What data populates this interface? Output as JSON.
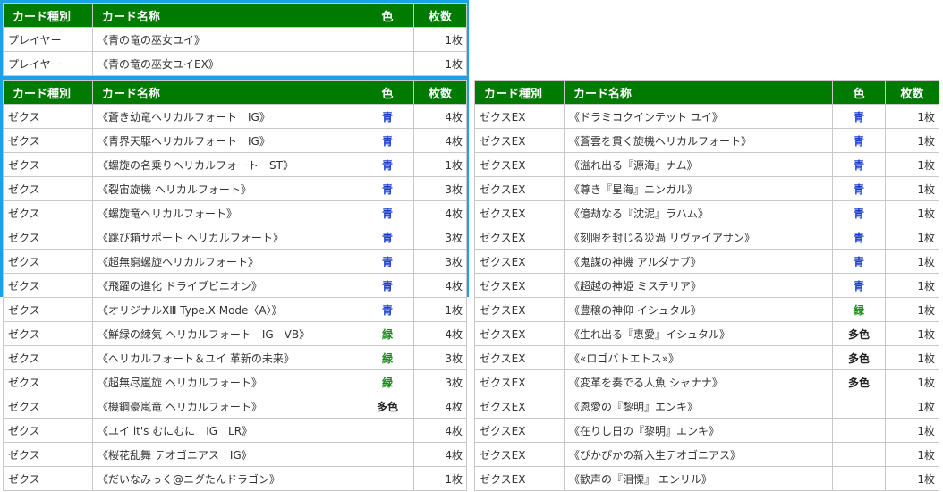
{
  "headers": {
    "type": "カード種別",
    "name": "カード名称",
    "color": "色",
    "count": "枚数"
  },
  "players": [
    {
      "type": "プレイヤー",
      "name": "《青の竜の巫女ユイ》",
      "color": "",
      "color_class": "",
      "count": "1枚"
    },
    {
      "type": "プレイヤー",
      "name": "《青の竜の巫女ユイEX》",
      "color": "",
      "color_class": "",
      "count": "1枚"
    }
  ],
  "zex": [
    {
      "type": "ゼクス",
      "name": "《蒼き幼竜ヘリカルフォート　IG》",
      "color": "青",
      "color_class": "blue",
      "count": "4枚"
    },
    {
      "type": "ゼクス",
      "name": "《青界天駆ヘリカルフォート　IG》",
      "color": "青",
      "color_class": "blue",
      "count": "4枚"
    },
    {
      "type": "ゼクス",
      "name": "《螺旋の名乗りヘリカルフォート　ST》",
      "color": "青",
      "color_class": "blue",
      "count": "1枚"
    },
    {
      "type": "ゼクス",
      "name": "《裂宙旋機 ヘリカルフォート》",
      "color": "青",
      "color_class": "blue",
      "count": "3枚"
    },
    {
      "type": "ゼクス",
      "name": "《螺旋竜ヘリカルフォート》",
      "color": "青",
      "color_class": "blue",
      "count": "4枚"
    },
    {
      "type": "ゼクス",
      "name": "《跳び箱サポート ヘリカルフォート》",
      "color": "青",
      "color_class": "blue",
      "count": "3枚"
    },
    {
      "type": "ゼクス",
      "name": "《超無窮螺旋ヘリカルフォート》",
      "color": "青",
      "color_class": "blue",
      "count": "3枚"
    },
    {
      "type": "ゼクス",
      "name": "《飛躍の進化 ドライブビニオン》",
      "color": "青",
      "color_class": "blue",
      "count": "4枚"
    },
    {
      "type": "ゼクス",
      "name": "《オリジナルXⅢ Type.X Mode〈A〉》",
      "color": "青",
      "color_class": "blue",
      "count": "1枚"
    },
    {
      "type": "ゼクス",
      "name": "《鮮緑の練気 ヘリカルフォート　IG　VB》",
      "color": "緑",
      "color_class": "green",
      "count": "4枚"
    },
    {
      "type": "ゼクス",
      "name": "《ヘリカルフォート＆ユイ 革新の未来》",
      "color": "緑",
      "color_class": "green",
      "count": "3枚"
    },
    {
      "type": "ゼクス",
      "name": "《超無尽嵐旋 ヘリカルフォート》",
      "color": "緑",
      "color_class": "green",
      "count": "3枚"
    },
    {
      "type": "ゼクス",
      "name": "《機鋼豪嵐竜 ヘリカルフォート》",
      "color": "多色",
      "color_class": "multi",
      "count": "4枚"
    },
    {
      "type": "ゼクス",
      "name": "《ユイ it's むにむに　IG　LR》",
      "color": "",
      "color_class": "",
      "count": "4枚"
    },
    {
      "type": "ゼクス",
      "name": "《桜花乱舞 テオゴニアス　IG》",
      "color": "",
      "color_class": "",
      "count": "4枚"
    },
    {
      "type": "ゼクス",
      "name": "《だいなみっく@ニグたんドラゴン》",
      "color": "",
      "color_class": "",
      "count": "1枚"
    }
  ],
  "zex_ex": [
    {
      "type": "ゼクスEX",
      "name": "《ドラミコクインテット ユイ》",
      "color": "青",
      "color_class": "blue",
      "count": "1枚"
    },
    {
      "type": "ゼクスEX",
      "name": "《蒼雲を貫く旋機ヘリカルフォート》",
      "color": "青",
      "color_class": "blue",
      "count": "1枚"
    },
    {
      "type": "ゼクスEX",
      "name": "《溢れ出る『源海』ナム》",
      "color": "青",
      "color_class": "blue",
      "count": "1枚"
    },
    {
      "type": "ゼクスEX",
      "name": "《尊き『星海』ニンガル》",
      "color": "青",
      "color_class": "blue",
      "count": "1枚"
    },
    {
      "type": "ゼクスEX",
      "name": "《億劫なる『沈泥』ラハム》",
      "color": "青",
      "color_class": "blue",
      "count": "1枚"
    },
    {
      "type": "ゼクスEX",
      "name": "《刻限を封じる災渦 リヴァイアサン》",
      "color": "青",
      "color_class": "blue",
      "count": "1枚"
    },
    {
      "type": "ゼクスEX",
      "name": "《鬼謀の神機 アルダナブ》",
      "color": "青",
      "color_class": "blue",
      "count": "1枚"
    },
    {
      "type": "ゼクスEX",
      "name": "《超越の神姫 ミステリア》",
      "color": "青",
      "color_class": "blue",
      "count": "1枚"
    },
    {
      "type": "ゼクスEX",
      "name": "《豊穣の神仰 イシュタル》",
      "color": "緑",
      "color_class": "green",
      "count": "1枚"
    },
    {
      "type": "ゼクスEX",
      "name": "《生れ出る『恵愛』イシュタル》",
      "color": "多色",
      "color_class": "multi",
      "count": "1枚"
    },
    {
      "type": "ゼクスEX",
      "name": "《«ロゴバトエトス»》",
      "color": "多色",
      "color_class": "multi",
      "count": "1枚"
    },
    {
      "type": "ゼクスEX",
      "name": "《変革を奏でる人魚 シャナナ》",
      "color": "多色",
      "color_class": "multi",
      "count": "1枚"
    },
    {
      "type": "ゼクスEX",
      "name": "《恩愛の『黎明』エンキ》",
      "color": "",
      "color_class": "",
      "count": "1枚"
    },
    {
      "type": "ゼクスEX",
      "name": "《在りし日の『黎明』エンキ》",
      "color": "",
      "color_class": "",
      "count": "1枚"
    },
    {
      "type": "ゼクスEX",
      "name": "《ぴかぴかの新入生テオゴニアス》",
      "color": "",
      "color_class": "",
      "count": "1枚"
    },
    {
      "type": "ゼクスEX",
      "name": "《歓声の『泪慄』 エンリル》",
      "color": "",
      "color_class": "",
      "count": "1枚"
    }
  ]
}
